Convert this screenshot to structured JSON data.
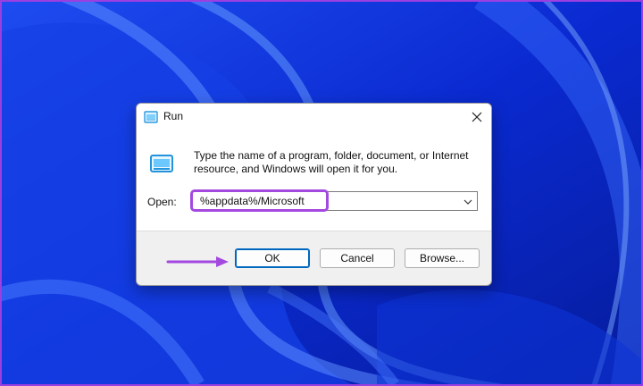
{
  "dialog": {
    "title": "Run",
    "description": "Type the name of a program, folder, document, or Internet resource, and Windows will open it for you.",
    "open_label": "Open:",
    "open_value": "%appdata%/Microsoft",
    "buttons": {
      "ok": "OK",
      "cancel": "Cancel",
      "browse": "Browse..."
    }
  },
  "icons": {
    "title": "run-icon",
    "body": "run-icon",
    "close": "close-icon",
    "dropdown": "chevron-down-icon",
    "annotation": "arrow-right-icon"
  },
  "colors": {
    "highlight": "#a349e0",
    "wallpaper": "#0b2fd6",
    "default_button_border": "#0067c0"
  }
}
